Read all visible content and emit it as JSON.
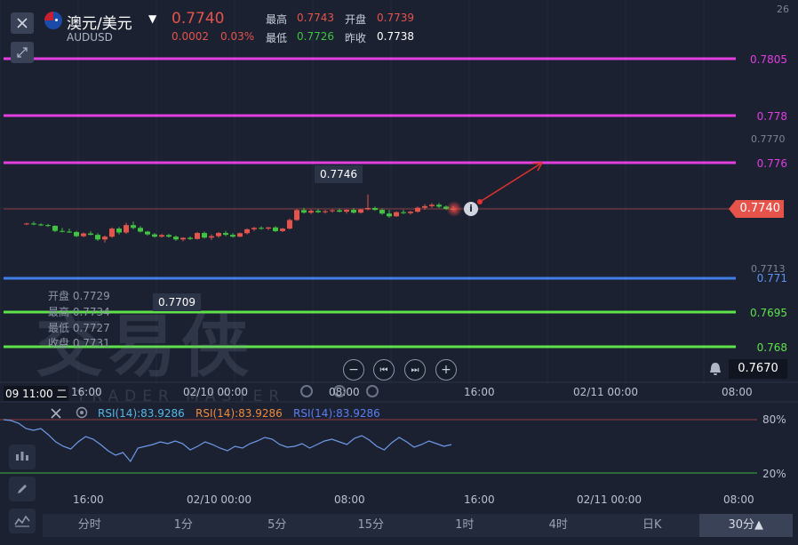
{
  "header": {
    "title": "澳元/美元",
    "symbol": "AUDUSD",
    "price": "0.7740",
    "change": "0.0002",
    "change_pct": "0.03%",
    "high_label": "最高",
    "high": "0.7743",
    "open_label": "开盘",
    "open": "0.7739",
    "low_label": "最低",
    "low": "0.7726",
    "prev_label": "昨收",
    "prev": "0.7738",
    "top_corner": "26"
  },
  "ohlc_tip": {
    "open": "开盘 0.7729",
    "high": "最高 0.7734",
    "low": "最低 0.7727",
    "close": "收盘 0.7731"
  },
  "levels": [
    {
      "label": "0.7805",
      "color": "#e23ee0"
    },
    {
      "label": "0.778",
      "color": "#e23ee0"
    },
    {
      "label": "0.776",
      "color": "#e23ee0"
    },
    {
      "label": "0.771",
      "color": "#3f7fe6"
    },
    {
      "label": "0.7695",
      "color": "#5ee24a"
    },
    {
      "label": "0.768",
      "color": "#5ee24a"
    }
  ],
  "axis": {
    "price_7770": "0.7770",
    "price_7713": "0.7713",
    "current_price": "0.7740",
    "bottom_price": "0.7670"
  },
  "annotations": {
    "peak_label": "0.7746",
    "trough_label": "0.7709",
    "cursor_time": "09 11:00 二"
  },
  "time_axis": [
    "16:00",
    "02/10 00:00",
    "08:00",
    "16:00",
    "02/11 00:00",
    "08:00"
  ],
  "rsi": {
    "label1": "RSI(14):83.9286",
    "label2": "RSI(14):83.9286",
    "label3": "RSI(14):83.9286",
    "level_high": "80%",
    "level_low": "20%",
    "values": [
      80,
      79,
      76,
      70,
      68,
      70,
      63,
      55,
      50,
      47,
      55,
      61,
      58,
      52,
      45,
      40,
      43,
      33,
      48,
      50,
      52,
      55,
      53,
      56,
      53,
      46,
      50,
      55,
      52,
      48,
      45,
      50,
      48,
      53,
      56,
      60,
      58,
      52,
      49,
      50,
      53,
      48,
      52,
      56,
      58,
      55,
      52,
      59,
      62,
      57,
      50,
      46,
      54,
      60,
      55,
      49,
      52,
      56,
      53,
      50,
      52
    ]
  },
  "watermark": {
    "cn": "交易侠",
    "en": "TRADER MASTER"
  },
  "tabs": [
    {
      "label": "分时",
      "active": false
    },
    {
      "label": "1分",
      "active": false
    },
    {
      "label": "5分",
      "active": false
    },
    {
      "label": "15分",
      "active": false
    },
    {
      "label": "1时",
      "active": false
    },
    {
      "label": "4时",
      "active": false
    },
    {
      "label": "日K",
      "active": false
    },
    {
      "label": "30分▲",
      "active": true
    }
  ],
  "colors": {
    "up": "#e5534b",
    "down": "#3ec43e",
    "rsi_line": "#6f9ae8",
    "bg": "#1b2131"
  },
  "candles": [
    [
      0.77335,
      0.7734,
      0.7733,
      0.77337
    ],
    [
      0.77337,
      0.77345,
      0.7733,
      0.77333
    ],
    [
      0.77333,
      0.77338,
      0.77326,
      0.7733
    ],
    [
      0.7733,
      0.77335,
      0.77322,
      0.77327
    ],
    [
      0.77327,
      0.77329,
      0.773,
      0.77305
    ],
    [
      0.77305,
      0.77318,
      0.77298,
      0.77302
    ],
    [
      0.77302,
      0.77315,
      0.77296,
      0.773
    ],
    [
      0.773,
      0.77305,
      0.77278,
      0.77282
    ],
    [
      0.77282,
      0.77298,
      0.77278,
      0.77294
    ],
    [
      0.77294,
      0.77304,
      0.77286,
      0.77288
    ],
    [
      0.77288,
      0.77295,
      0.77262,
      0.77268
    ],
    [
      0.77268,
      0.77285,
      0.77255,
      0.7728
    ],
    [
      0.7728,
      0.7732,
      0.77275,
      0.77315
    ],
    [
      0.77315,
      0.77322,
      0.7729,
      0.77298
    ],
    [
      0.77298,
      0.7734,
      0.77292,
      0.7733
    ],
    [
      0.7733,
      0.77345,
      0.77312,
      0.77318
    ],
    [
      0.77318,
      0.77326,
      0.77298,
      0.77302
    ],
    [
      0.77302,
      0.77305,
      0.77285,
      0.7729
    ],
    [
      0.7729,
      0.77296,
      0.77276,
      0.7728
    ],
    [
      0.7728,
      0.77292,
      0.77276,
      0.77287
    ],
    [
      0.77287,
      0.77292,
      0.77276,
      0.7728
    ],
    [
      0.7728,
      0.77285,
      0.77262,
      0.77268
    ],
    [
      0.77268,
      0.77278,
      0.7726,
      0.77275
    ],
    [
      0.77275,
      0.77281,
      0.77266,
      0.7727
    ],
    [
      0.7727,
      0.773,
      0.77268,
      0.77296
    ],
    [
      0.77296,
      0.77302,
      0.77272,
      0.77276
    ],
    [
      0.77276,
      0.7729,
      0.77266,
      0.77282
    ],
    [
      0.77282,
      0.773,
      0.77275,
      0.77296
    ],
    [
      0.77296,
      0.77305,
      0.77282,
      0.77288
    ],
    [
      0.77288,
      0.77295,
      0.77276,
      0.7728
    ],
    [
      0.7728,
      0.77298,
      0.77278,
      0.77295
    ],
    [
      0.77295,
      0.77316,
      0.7729,
      0.77312
    ],
    [
      0.77312,
      0.77322,
      0.77305,
      0.77318
    ],
    [
      0.77318,
      0.77325,
      0.7731,
      0.77315
    ],
    [
      0.77315,
      0.77322,
      0.77308,
      0.7732
    ],
    [
      0.7732,
      0.77325,
      0.773,
      0.77304
    ],
    [
      0.77304,
      0.77318,
      0.773,
      0.77315
    ],
    [
      0.77315,
      0.77358,
      0.77312,
      0.77352
    ],
    [
      0.77352,
      0.774,
      0.77348,
      0.77395
    ],
    [
      0.77395,
      0.77405,
      0.7738,
      0.77384
    ],
    [
      0.77384,
      0.77398,
      0.77378,
      0.77392
    ],
    [
      0.77392,
      0.774,
      0.77382,
      0.77386
    ],
    [
      0.77386,
      0.77396,
      0.7738,
      0.7739
    ],
    [
      0.7739,
      0.77398,
      0.77384,
      0.77394
    ],
    [
      0.77394,
      0.77402,
      0.77385,
      0.77388
    ],
    [
      0.77388,
      0.77398,
      0.7738,
      0.77396
    ],
    [
      0.77396,
      0.77404,
      0.7738,
      0.77384
    ],
    [
      0.77384,
      0.774,
      0.7738,
      0.77398
    ],
    [
      0.77398,
      0.77462,
      0.77394,
      0.77404
    ],
    [
      0.77404,
      0.7741,
      0.77392,
      0.77396
    ],
    [
      0.77396,
      0.77402,
      0.77375,
      0.7738
    ],
    [
      0.7738,
      0.77395,
      0.77362,
      0.77368
    ],
    [
      0.77368,
      0.7739,
      0.77366,
      0.77386
    ],
    [
      0.77386,
      0.77396,
      0.77378,
      0.77382
    ],
    [
      0.77382,
      0.77392,
      0.77376,
      0.77388
    ],
    [
      0.77388,
      0.7741,
      0.77384,
      0.77405
    ],
    [
      0.77405,
      0.7742,
      0.77396,
      0.77412
    ],
    [
      0.77412,
      0.77425,
      0.77405,
      0.77418
    ],
    [
      0.77418,
      0.77426,
      0.77404,
      0.7741
    ],
    [
      0.7741,
      0.77415,
      0.77395,
      0.774
    ],
    [
      0.774,
      0.77412,
      0.77394,
      0.77398
    ]
  ]
}
